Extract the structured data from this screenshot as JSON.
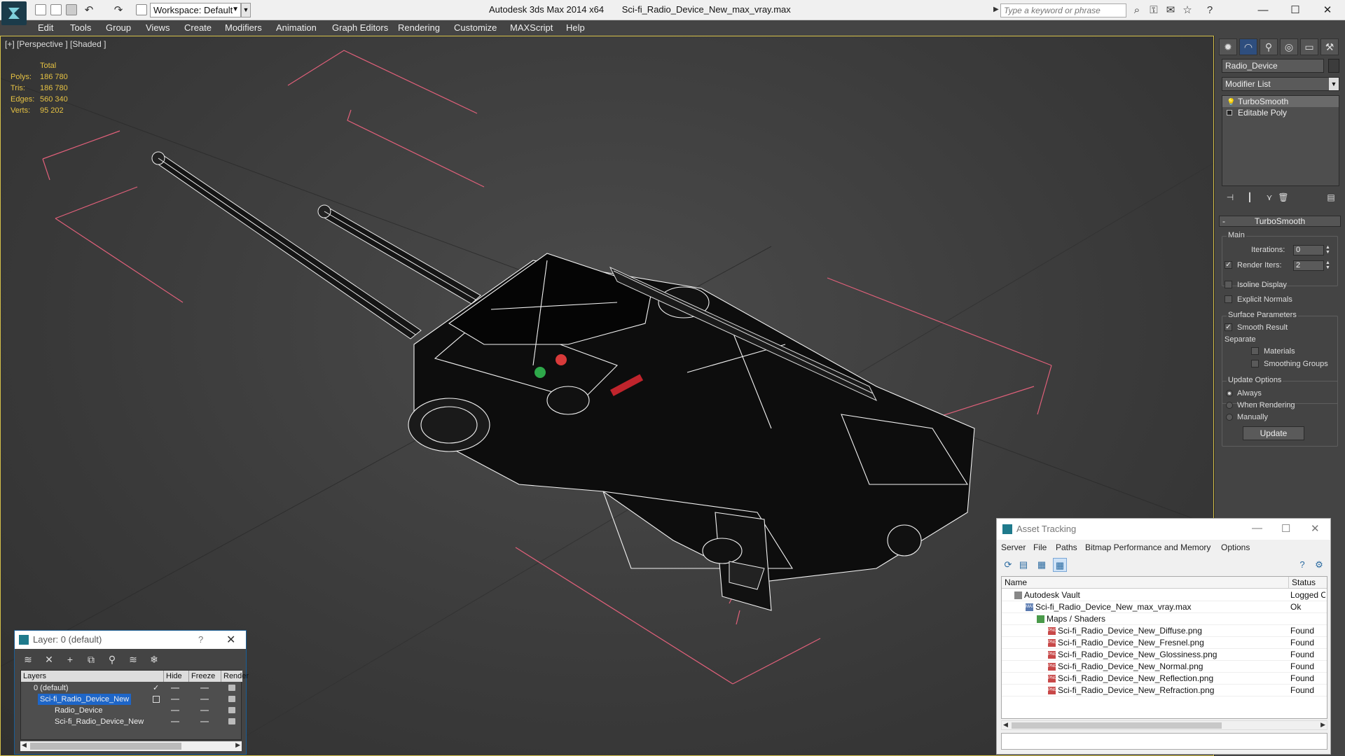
{
  "titlebar": {
    "workspace": "Workspace: Default",
    "app_version": "Autodesk 3ds Max  2014 x64",
    "file_name": "Sci-fi_Radio_Device_New_max_vray.max",
    "search_placeholder": "Type a keyword or phrase"
  },
  "menu": [
    "Edit",
    "Tools",
    "Group",
    "Views",
    "Create",
    "Modifiers",
    "Animation",
    "Graph Editors",
    "Rendering",
    "Customize",
    "MAXScript",
    "Help"
  ],
  "viewport": {
    "label": "[+] [Perspective ] [Shaded ]",
    "stats": {
      "header": "Total",
      "rows": [
        {
          "label": "Polys:",
          "value": "186 780"
        },
        {
          "label": "Tris:",
          "value": "186 780"
        },
        {
          "label": "Edges:",
          "value": "560 340"
        },
        {
          "label": "Verts:",
          "value": "95 202"
        }
      ]
    }
  },
  "command_panel": {
    "object_name": "Radio_Device",
    "modifier_list": "Modifier List",
    "stack": [
      "TurboSmooth",
      "Editable Poly"
    ],
    "rollout_title": "TurboSmooth",
    "main_group": "Main",
    "iterations_label": "Iterations:",
    "iterations_value": "0",
    "render_iters_label": "Render Iters:",
    "render_iters_value": "2",
    "render_iters_checked": "✓",
    "isoline_display": "Isoline Display",
    "explicit_normals": "Explicit Normals",
    "surface_group": "Surface Parameters",
    "smooth_result": "Smooth Result",
    "smooth_result_checked": "✓",
    "separate_label": "Separate",
    "materials": "Materials",
    "smoothing_groups": "Smoothing Groups",
    "update_group": "Update Options",
    "always": "Always",
    "when_rendering": "When Rendering",
    "manually": "Manually",
    "update_button": "Update"
  },
  "layer_dialog": {
    "title": "Layer: 0 (default)",
    "help": "?",
    "columns": [
      "Layers",
      "Hide",
      "Freeze",
      "Render"
    ],
    "rows": [
      {
        "name": "0 (default)",
        "indent": 0
      },
      {
        "name": "Sci-fi_Radio_Device_New",
        "indent": 0
      },
      {
        "name": "Radio_Device",
        "indent": 1
      },
      {
        "name": "Sci-fi_Radio_Device_New",
        "indent": 1
      }
    ]
  },
  "asset_tracking": {
    "title": "Asset Tracking",
    "menu": [
      "Server",
      "File",
      "Paths",
      "Bitmap Performance and Memory",
      "Options"
    ],
    "columns": [
      "Name",
      "Status"
    ],
    "rows": [
      {
        "name": "Autodesk Vault",
        "status": "Logged O",
        "icon": "vault"
      },
      {
        "name": "Sci-fi_Radio_Device_New_max_vray.max",
        "status": "Ok",
        "icon": "max"
      },
      {
        "name": "Maps / Shaders",
        "status": "",
        "icon": "folder"
      },
      {
        "name": "Sci-fi_Radio_Device_New_Diffuse.png",
        "status": "Found",
        "icon": "png"
      },
      {
        "name": "Sci-fi_Radio_Device_New_Fresnel.png",
        "status": "Found",
        "icon": "png"
      },
      {
        "name": "Sci-fi_Radio_Device_New_Glossiness.png",
        "status": "Found",
        "icon": "png"
      },
      {
        "name": "Sci-fi_Radio_Device_New_Normal.png",
        "status": "Found",
        "icon": "png"
      },
      {
        "name": "Sci-fi_Radio_Device_New_Reflection.png",
        "status": "Found",
        "icon": "png"
      },
      {
        "name": "Sci-fi_Radio_Device_New_Refraction.png",
        "status": "Found",
        "icon": "png"
      }
    ]
  },
  "colors": {
    "viewport_border": "#d6c14a",
    "stats_text": "#e6c243",
    "gizmo_pink": "#e0607a",
    "selection_blue": "#1e66c8"
  }
}
